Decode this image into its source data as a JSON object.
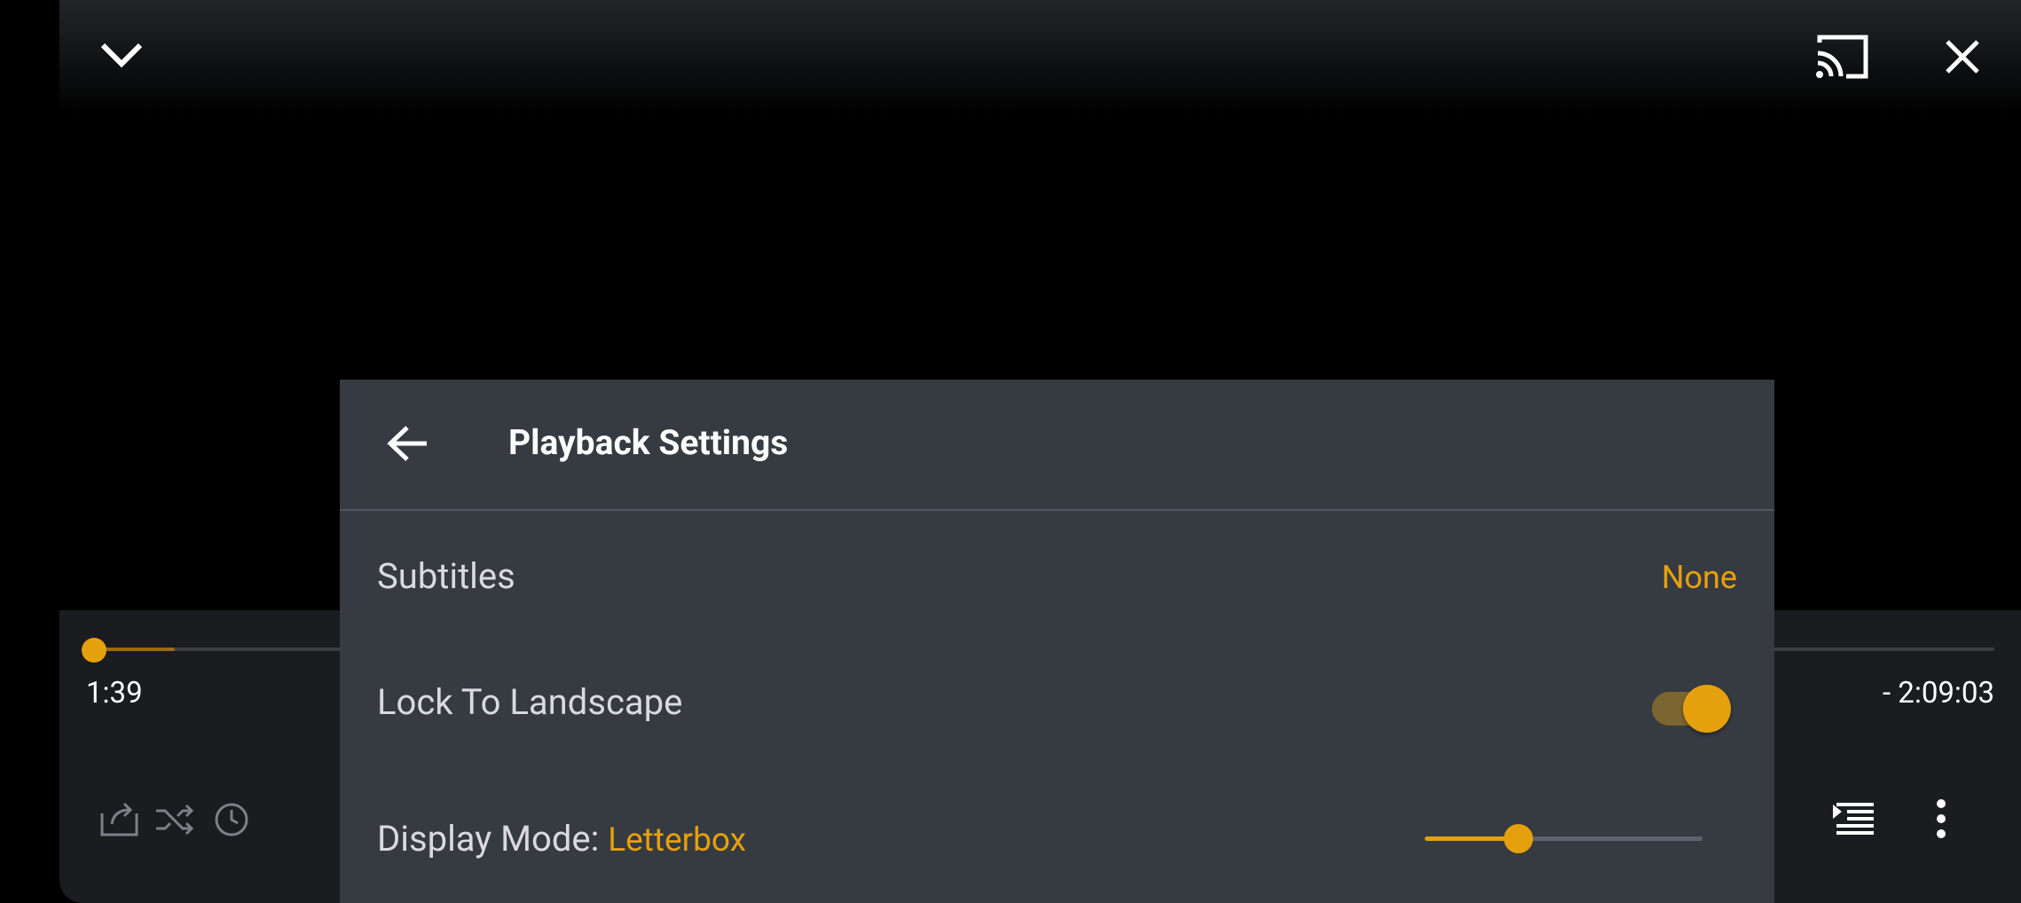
{
  "top_bar": {
    "collapse_icon": "chevron-down-icon",
    "cast_icon": "cast-icon",
    "close_icon": "close-icon"
  },
  "player": {
    "elapsed": "1:39",
    "remaining": "- 2:09:03",
    "progress_fraction": 0.0128,
    "left_icons": [
      "share-icon",
      "shuffle-icon",
      "clock-icon"
    ],
    "right_icons": [
      "queue-icon",
      "more-vert-icon"
    ]
  },
  "settings_panel": {
    "back_icon": "arrow-back-icon",
    "title": "Playback Settings",
    "subtitles": {
      "label": "Subtitles",
      "value": "None"
    },
    "lock_landscape": {
      "label": "Lock To Landscape",
      "enabled": true
    },
    "display_mode": {
      "label": "Display Mode:",
      "value": "Letterbox",
      "slider_fraction": 0.33
    }
  },
  "colors": {
    "accent": "#e5a00d",
    "panel": "#363a41",
    "background": "#000000"
  }
}
